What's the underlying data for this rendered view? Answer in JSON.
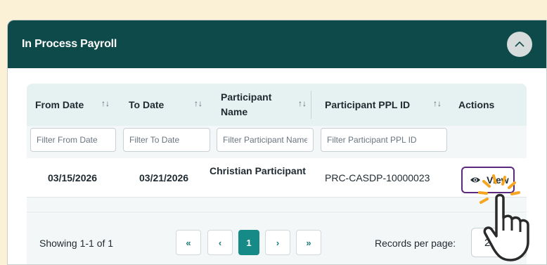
{
  "panel": {
    "title": "In Process Payroll",
    "collapse_icon": "chevron-up-icon"
  },
  "table": {
    "columns": [
      {
        "key": "from_date",
        "label": "From Date",
        "filter_placeholder": "Filter From Date"
      },
      {
        "key": "to_date",
        "label": "To Date",
        "filter_placeholder": "Filter To Date"
      },
      {
        "key": "participant_name",
        "label": "Participant Name",
        "filter_placeholder": "Filter Participant Name"
      },
      {
        "key": "participant_ppl_id",
        "label": "Participant PPL ID",
        "filter_placeholder": "Filter Participant PPL ID"
      },
      {
        "key": "actions",
        "label": "Actions"
      }
    ],
    "rows": [
      {
        "from_date": "03/15/2026",
        "to_date": "03/21/2026",
        "participant_name": "Christian Participant",
        "participant_ppl_id": "PRC-CASDP-10000023",
        "action_label": "View"
      }
    ]
  },
  "pagination": {
    "showing": "Showing 1-1 of 1",
    "first": "«",
    "prev": "‹",
    "current_page": "1",
    "next": "›",
    "last": "»",
    "records_label": "Records per page:",
    "per_page": "20"
  },
  "colors": {
    "header_bg": "#0e4a49",
    "accent": "#168a87",
    "view_border": "#5b2a7d",
    "page_bg": "#fbf1d6"
  }
}
